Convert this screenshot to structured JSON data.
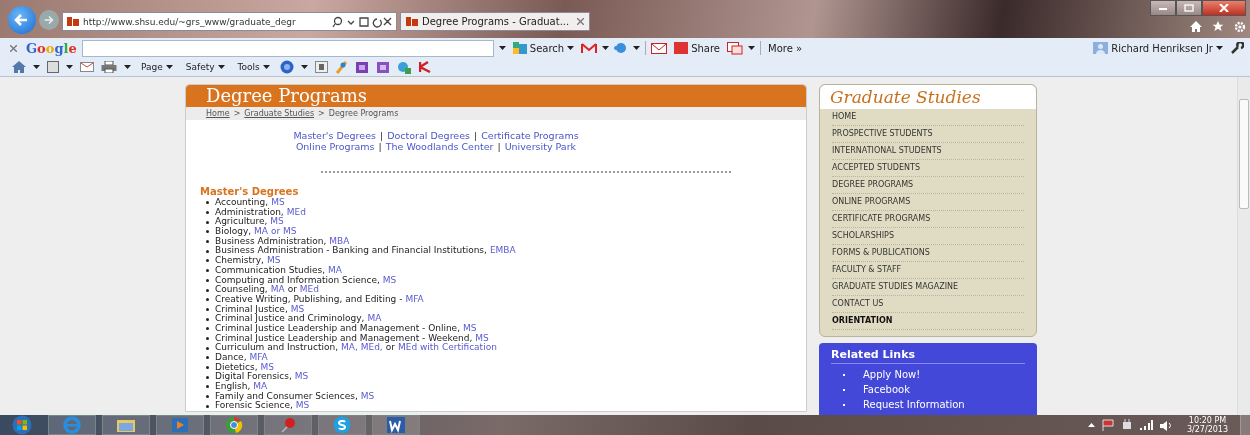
{
  "browser": {
    "url": "http://www.shsu.edu/~grs_www/graduate_degr",
    "tab": {
      "title": "Degree Programs - Graduat...",
      "selected": true
    }
  },
  "google_bar": {
    "logo": "Google",
    "search_label": "Search",
    "share_label": "Share",
    "more_label": "More »",
    "user": "Richard Henriksen Jr"
  },
  "command_bar": {
    "menus": [
      "Page",
      "Safety",
      "Tools"
    ]
  },
  "page": {
    "title": "Degree Programs",
    "breadcrumb": [
      {
        "text": "Home",
        "kind": "link"
      },
      {
        "text": ">",
        "kind": "sep"
      },
      {
        "text": "Graduate Studies",
        "kind": "link"
      },
      {
        "text": ">",
        "kind": "sep"
      },
      {
        "text": "Degree Programs",
        "kind": "current"
      }
    ],
    "quick_links": [
      [
        {
          "text": "Master's Degrees",
          "kind": "link"
        },
        {
          "text": "|",
          "kind": "sep"
        },
        {
          "text": "Doctoral Degrees",
          "kind": "link"
        },
        {
          "text": "|",
          "kind": "sep"
        },
        {
          "text": "Certificate Programs",
          "kind": "link"
        }
      ],
      [
        {
          "text": "Online Programs",
          "kind": "link"
        },
        {
          "text": "|",
          "kind": "sep"
        },
        {
          "text": "The Woodlands Center",
          "kind": "link"
        },
        {
          "text": "|",
          "kind": "sep"
        },
        {
          "text": "University Park",
          "kind": "link"
        }
      ]
    ],
    "section_title": "Master's Degrees",
    "degrees": [
      [
        {
          "text": "Accounting,",
          "kind": "plain"
        },
        {
          "text": "MS",
          "kind": "link"
        }
      ],
      [
        {
          "text": "Administration,",
          "kind": "plain"
        },
        {
          "text": "MEd",
          "kind": "link"
        }
      ],
      [
        {
          "text": "Agriculture,",
          "kind": "plain"
        },
        {
          "text": "MS",
          "kind": "link"
        }
      ],
      [
        {
          "text": "Biology,",
          "kind": "plain"
        },
        {
          "text": "MA or MS",
          "kind": "link"
        }
      ],
      [
        {
          "text": "Business Administration,",
          "kind": "plain"
        },
        {
          "text": "MBA",
          "kind": "link"
        }
      ],
      [
        {
          "text": "Business Administration - Banking and Financial Institutions,",
          "kind": "plain"
        },
        {
          "text": "EMBA",
          "kind": "link"
        }
      ],
      [
        {
          "text": "Chemistry,",
          "kind": "plain"
        },
        {
          "text": "MS",
          "kind": "link"
        }
      ],
      [
        {
          "text": "Communication Studies,",
          "kind": "plain"
        },
        {
          "text": "MA",
          "kind": "link"
        }
      ],
      [
        {
          "text": "Computing and Information Science,",
          "kind": "plain"
        },
        {
          "text": "MS",
          "kind": "link"
        }
      ],
      [
        {
          "text": "Counseling,",
          "kind": "plain"
        },
        {
          "text": "MA",
          "kind": "link"
        },
        {
          "text": "or",
          "kind": "plain"
        },
        {
          "text": "MEd",
          "kind": "link"
        }
      ],
      [
        {
          "text": "Creative Writing, Publishing, and Editing -",
          "kind": "plain"
        },
        {
          "text": "MFA",
          "kind": "link"
        }
      ],
      [
        {
          "text": "Criminal Justice,",
          "kind": "plain"
        },
        {
          "text": "MS",
          "kind": "link"
        }
      ],
      [
        {
          "text": "Criminal Justice and Criminology,",
          "kind": "plain"
        },
        {
          "text": "MA",
          "kind": "link"
        }
      ],
      [
        {
          "text": "Criminal Justice Leadership and Management - Online,",
          "kind": "plain"
        },
        {
          "text": "MS",
          "kind": "link"
        }
      ],
      [
        {
          "text": "Criminal Justice Leadership and Management - Weekend,",
          "kind": "plain"
        },
        {
          "text": "MS",
          "kind": "link"
        }
      ],
      [
        {
          "text": "Curriculum and Instruction,",
          "kind": "plain"
        },
        {
          "text": "MA, MEd,",
          "kind": "link"
        },
        {
          "text": "or",
          "kind": "plain"
        },
        {
          "text": "MEd with Certification",
          "kind": "link"
        }
      ],
      [
        {
          "text": "Dance,",
          "kind": "plain"
        },
        {
          "text": "MFA",
          "kind": "link"
        }
      ],
      [
        {
          "text": "Dietetics,",
          "kind": "plain"
        },
        {
          "text": "MS",
          "kind": "link"
        }
      ],
      [
        {
          "text": "Digital Forensics,",
          "kind": "plain"
        },
        {
          "text": "MS",
          "kind": "link"
        }
      ],
      [
        {
          "text": "English,",
          "kind": "plain"
        },
        {
          "text": "MA",
          "kind": "link"
        }
      ],
      [
        {
          "text": "Family and Consumer Sciences,",
          "kind": "plain"
        },
        {
          "text": "MS",
          "kind": "link"
        }
      ],
      [
        {
          "text": "Forensic Science,",
          "kind": "plain"
        },
        {
          "text": "MS",
          "kind": "link"
        }
      ]
    ]
  },
  "sidebar": {
    "title": "Graduate Studies",
    "items": [
      {
        "label": "HOME",
        "selected": false
      },
      {
        "label": "PROSPECTIVE STUDENTS",
        "selected": false
      },
      {
        "label": "INTERNATIONAL STUDENTS",
        "selected": false
      },
      {
        "label": "ACCEPTED STUDENTS",
        "selected": false
      },
      {
        "label": "DEGREE PROGRAMS",
        "selected": false
      },
      {
        "label": "ONLINE PROGRAMS",
        "selected": false
      },
      {
        "label": "CERTIFICATE PROGRAMS",
        "selected": false
      },
      {
        "label": "SCHOLARSHIPS",
        "selected": false
      },
      {
        "label": "FORMS & PUBLICATIONS",
        "selected": false
      },
      {
        "label": "FACULTY & STAFF",
        "selected": false
      },
      {
        "label": "GRADUATE STUDIES MAGAZINE",
        "selected": false
      },
      {
        "label": "CONTACT US",
        "selected": false
      },
      {
        "label": "ORIENTATION",
        "selected": true
      }
    ],
    "related_title": "Related Links",
    "related": [
      "Apply Now!",
      "Facebook",
      "Request Information"
    ]
  },
  "taskbar": {
    "time": "10:20 PM",
    "date": "3/27/2013"
  }
}
